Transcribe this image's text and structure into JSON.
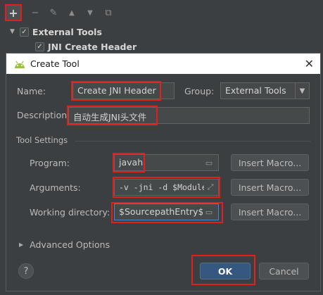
{
  "toolbar": {
    "add_glyph": "+",
    "remove_glyph": "−",
    "edit_glyph": "✎",
    "up_glyph": "▲",
    "down_glyph": "▼",
    "copy_glyph": "⧉"
  },
  "tree": {
    "group_label": "External Tools",
    "item_label": "JNI Create Header"
  },
  "dialog": {
    "title": "Create Tool",
    "close_glyph": "✕",
    "name_label": "Name:",
    "name_value": "Create JNI Header",
    "group_label": "Group:",
    "group_value": "External Tools",
    "description_label": "Description:",
    "description_value": "自动生成JNI头文件",
    "tool_settings_label": "Tool Settings",
    "program_label": "Program:",
    "program_value": "javah",
    "arguments_label": "Arguments:",
    "arguments_value": "-v -jni -d $ModuleFi",
    "working_dir_label": "Working directory:",
    "working_dir_value": "$SourcepathEntry$",
    "insert_macro_label": "Insert Macro...",
    "advanced_label": "Advanced Options",
    "ok_label": "OK",
    "cancel_label": "Cancel",
    "help_glyph": "?"
  },
  "colors": {
    "background": "#3c3f41",
    "field_bg": "#45494a",
    "primary_button": "#365880",
    "annotation_red": "#e0201c"
  }
}
